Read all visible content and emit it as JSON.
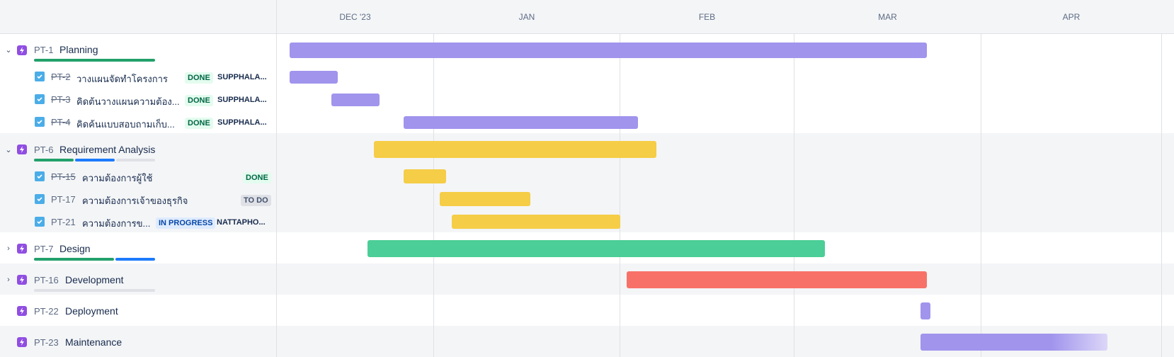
{
  "colors": {
    "purple": "#a094ed",
    "yellow": "#f5cd47",
    "green": "#4bce97",
    "red": "#f87168",
    "progress_done": "#22a06b",
    "progress_inprogress": "#1d7afc",
    "progress_todo": "#dfe1e6"
  },
  "timeline": {
    "months": [
      "DEC '23",
      "JAN",
      "FEB",
      "MAR",
      "APR"
    ]
  },
  "rows": [
    {
      "type": "epic",
      "expanded": true,
      "key": "PT-1",
      "title": "Planning",
      "progress": {
        "done": 1.0,
        "in_progress": 0,
        "todo": 0
      }
    },
    {
      "type": "task",
      "key": "PT-2",
      "key_done": true,
      "title": "วางแผนจัดทำโครงการ",
      "status": "DONE",
      "assignee": "SUPPHALA..."
    },
    {
      "type": "task",
      "key": "PT-3",
      "key_done": true,
      "title": "คิดต้นวางแผนความต้อง...",
      "status": "DONE",
      "assignee": "SUPPHALA..."
    },
    {
      "type": "task",
      "key": "PT-4",
      "key_done": true,
      "title": "คิดค้นแบบสอบถามเก็บ...",
      "status": "DONE",
      "assignee": "SUPPHALA..."
    },
    {
      "type": "epic",
      "expanded": true,
      "key": "PT-6",
      "title": "Requirement Analysis",
      "progress": {
        "done": 0.33,
        "in_progress": 0.33,
        "todo": 0.34
      }
    },
    {
      "type": "task",
      "key": "PT-15",
      "key_done": true,
      "title": "ความต้องการผู้ใช้",
      "status": "DONE",
      "assignee": ""
    },
    {
      "type": "task",
      "key": "PT-17",
      "key_done": false,
      "title": "ความต้องการเจ้าของธุรกิจ",
      "status": "TO DO",
      "assignee": ""
    },
    {
      "type": "task",
      "key": "PT-21",
      "key_done": false,
      "title": "ความต้องการข...",
      "status": "IN PROGRESS",
      "assignee": "NATTAPHO..."
    },
    {
      "type": "epic",
      "expanded": false,
      "key": "PT-7",
      "title": "Design",
      "progress": {
        "done": 0.67,
        "in_progress": 0.33,
        "todo": 0
      }
    },
    {
      "type": "epic",
      "expanded": false,
      "key": "PT-16",
      "title": "Development",
      "progress": {
        "done": 0,
        "in_progress": 0,
        "todo": 1.0
      }
    },
    {
      "type": "epic",
      "expanded": null,
      "key": "PT-22",
      "title": "Deployment",
      "progress": null
    },
    {
      "type": "epic",
      "expanded": null,
      "key": "PT-23",
      "title": "Maintenance",
      "progress": null
    }
  ]
}
